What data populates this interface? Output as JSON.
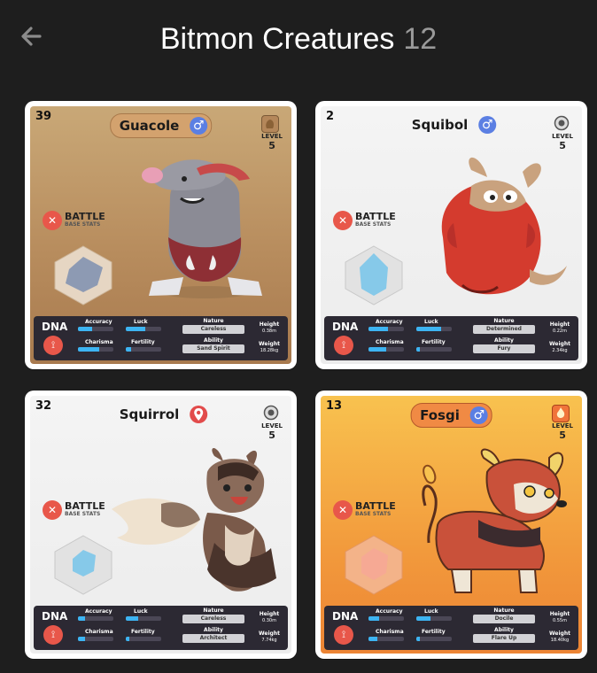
{
  "header": {
    "back_icon": "arrow-left-icon",
    "title": "Bitmon Creatures",
    "count": "12"
  },
  "colors": {
    "background": "#1e1e1e",
    "male": "#5b7fe3",
    "location": "#e24b4b",
    "battle_accent": "#e8574a",
    "dna_panel": "#2c2933",
    "stat_fill": "#3db4f2"
  },
  "labels": {
    "level": "LEVEL",
    "battle": "BATTLE",
    "battle_sub": "BASE STATS",
    "dna": "DNA",
    "accuracy": "Accuracy",
    "luck": "Luck",
    "charisma": "Charisma",
    "fertility": "Fertility",
    "nature": "Nature",
    "ability": "Ability",
    "height": "Height",
    "weight": "Weight"
  },
  "cards": [
    {
      "number": "39",
      "name": "Guacole",
      "gender_icon": "male-icon",
      "type_icon": "rock-type-icon",
      "level": "5",
      "nature": "Careless",
      "ability": "Sand Spirit",
      "height": "0.38m",
      "weight": "18.28kg",
      "accuracy": 0.4,
      "luck": 0.55,
      "charisma": 0.6,
      "fertility": 0.15
    },
    {
      "number": "2",
      "name": "Squibol",
      "gender_icon": "male-icon",
      "type_icon": "normal-type-icon",
      "level": "5",
      "nature": "Determined",
      "ability": "Fury",
      "height": "0.22m",
      "weight": "2.34kg",
      "accuracy": 0.55,
      "luck": 0.7,
      "charisma": 0.5,
      "fertility": 0.1
    },
    {
      "number": "32",
      "name": "Squirrol",
      "gender_icon": "location-icon",
      "type_icon": "normal-type-icon",
      "level": "5",
      "nature": "Careless",
      "ability": "Architect",
      "height": "0.30m",
      "weight": "7.74kg",
      "accuracy": 0.2,
      "luck": 0.35,
      "charisma": 0.2,
      "fertility": 0.1
    },
    {
      "number": "13",
      "name": "Fosgi",
      "gender_icon": "male-icon",
      "type_icon": "fire-type-icon",
      "level": "5",
      "nature": "Docile",
      "ability": "Flare Up",
      "height": "0.55m",
      "weight": "18.40kg",
      "accuracy": 0.3,
      "luck": 0.4,
      "charisma": 0.25,
      "fertility": 0.1
    }
  ]
}
